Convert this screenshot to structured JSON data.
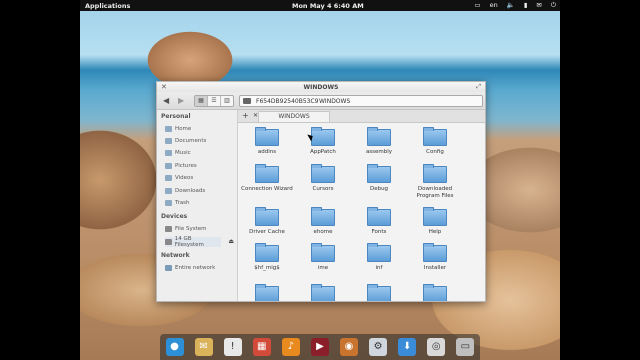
{
  "topbar": {
    "apps_label": "Applications",
    "clock": "Mon May  4  6:40 AM",
    "lang": "en",
    "icons": [
      "window-icon",
      "volume-icon",
      "battery-icon",
      "mail-icon",
      "power-icon"
    ]
  },
  "window": {
    "title": "WINDOWS",
    "path": [
      "F654DB92540B53C9",
      "WINDOWS"
    ],
    "tab_label": "WINDOWS"
  },
  "sidebar": {
    "personal_label": "Personal",
    "personal": [
      "Home",
      "Documents",
      "Music",
      "Pictures",
      "Videos",
      "Downloads",
      "Trash"
    ],
    "devices_label": "Devices",
    "devices": [
      "File System",
      "14 GB Filesystem"
    ],
    "network_label": "Network",
    "network": [
      "Entire network"
    ]
  },
  "files": [
    "addins",
    "AppPatch",
    "assembly",
    "Config",
    "Connection Wizard",
    "Cursors",
    "Debug",
    "Downloaded\nProgram Files",
    "Driver Cache",
    "ehome",
    "Fonts",
    "Help",
    "$hf_mig$",
    "ime",
    "inf",
    "Installer",
    "",
    "",
    "",
    ""
  ],
  "colors": {
    "accent": "#5c9dd8",
    "topbar": "#111111"
  }
}
